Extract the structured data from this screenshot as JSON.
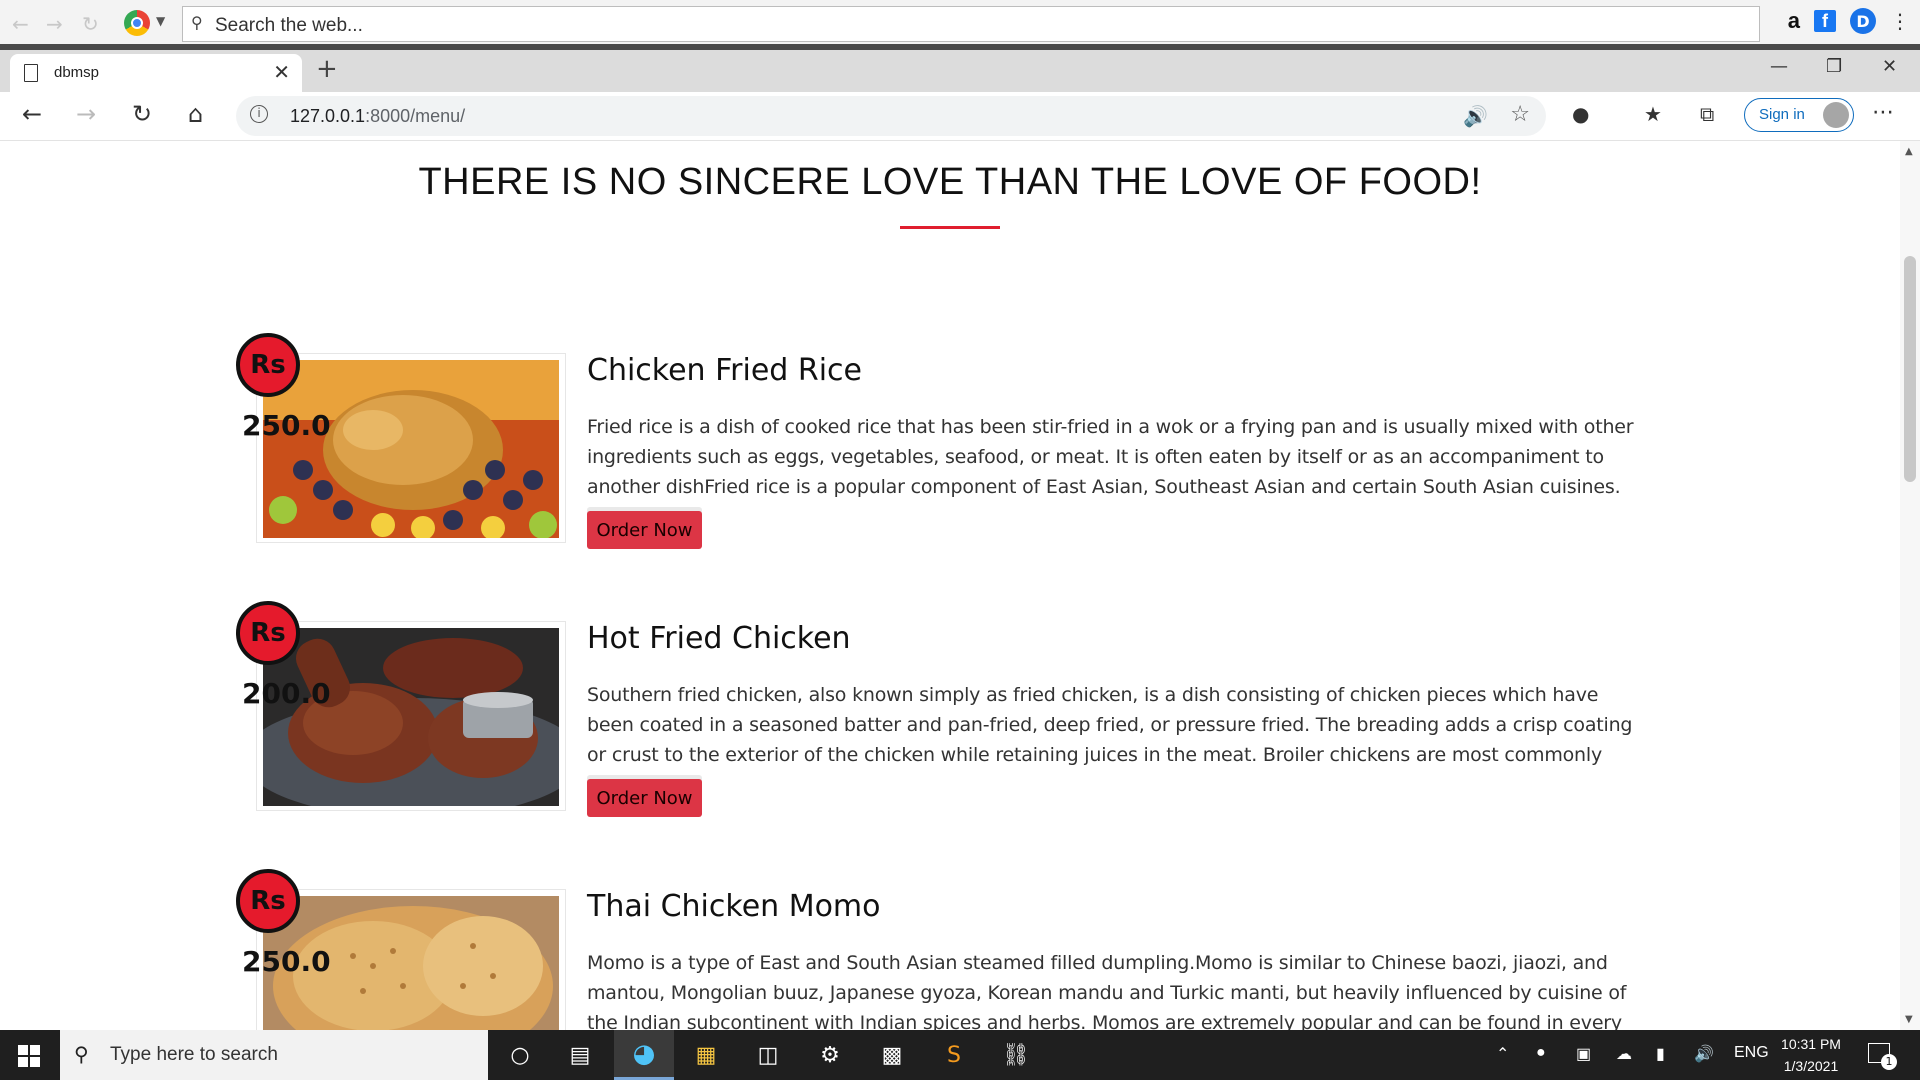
{
  "websearch": {
    "placeholder": "Search the web..."
  },
  "top_icons": [
    "amazon-icon",
    "facebook-icon",
    "d-extension-icon",
    "more-icon"
  ],
  "tab": {
    "title": "dbmsp"
  },
  "address": {
    "host": "127.0.0.1",
    "rest": ":8000/menu/"
  },
  "toolbar": {
    "signin_label": "Sign in"
  },
  "page": {
    "headline": "THERE IS NO SINCERE LOVE THAN THE LOVE OF FOOD!",
    "accent_color": "#e01e2e",
    "items": [
      {
        "badge": "Rs",
        "price": "250.0",
        "name": "Chicken Fried Rice",
        "description": "Fried rice is a dish of cooked rice that has been stir-fried in a wok or a frying pan and is usually mixed with other ingredients such as eggs, vegetables, seafood, or meat. It is often eaten by itself or as an accompaniment to another dishFried rice is a popular component of East Asian, Southeast Asian and certain South Asian cuisines.",
        "button": "Order Now"
      },
      {
        "badge": "Rs",
        "price": "200.0",
        "name": "Hot Fried Chicken",
        "description": "Southern fried chicken, also known simply as fried chicken, is a dish consisting of chicken pieces which have been coated in a seasoned batter and pan-fried, deep fried, or pressure fried. The breading adds a crisp coating or crust to the exterior of the chicken while retaining juices in the meat. Broiler chickens are most commonly used.",
        "button": "Order Now"
      },
      {
        "badge": "Rs",
        "price": "250.0",
        "name": "Thai Chicken Momo",
        "description": "Momo is a type of East and South Asian steamed filled dumpling.Momo is similar to Chinese baozi, jiaozi, and mantou, Mongolian buuz, Japanese gyoza, Korean mandu and Turkic manti, but heavily influenced by cuisine of the Indian subcontinent with Indian spices and herbs. Momos are extremely popular and can be found in every",
        "button": "Order Now"
      }
    ]
  },
  "taskbar": {
    "search_placeholder": "Type here to search",
    "language": "ENG",
    "time": "10:31 PM",
    "date": "1/3/2021",
    "notification_count": "1"
  }
}
